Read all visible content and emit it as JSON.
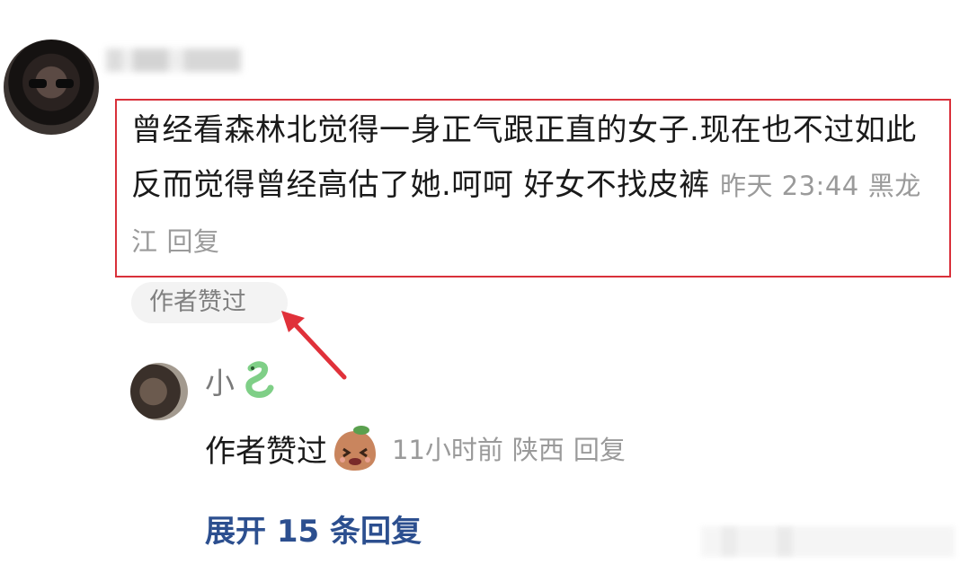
{
  "comment": {
    "text": "曾经看森林北觉得一身正气跟正直的女子.现在也不过如此反而觉得曾经高估了她.呵呵  好女不找皮裤",
    "time": "昨天 23:44",
    "location": "黑龙江",
    "reply_label": "回复",
    "author_liked_badge": "作者赞过",
    "highlight_color": "#d9303a"
  },
  "reply": {
    "username": "小",
    "username_icon": "snake-emoji-icon",
    "text": "作者赞过",
    "emoji": "shy-emoji-icon",
    "time": "11小时前",
    "location": "陕西",
    "reply_label": "回复"
  },
  "expand_replies_label": "展开 15 条回复",
  "link_color": "#2c4f8f"
}
